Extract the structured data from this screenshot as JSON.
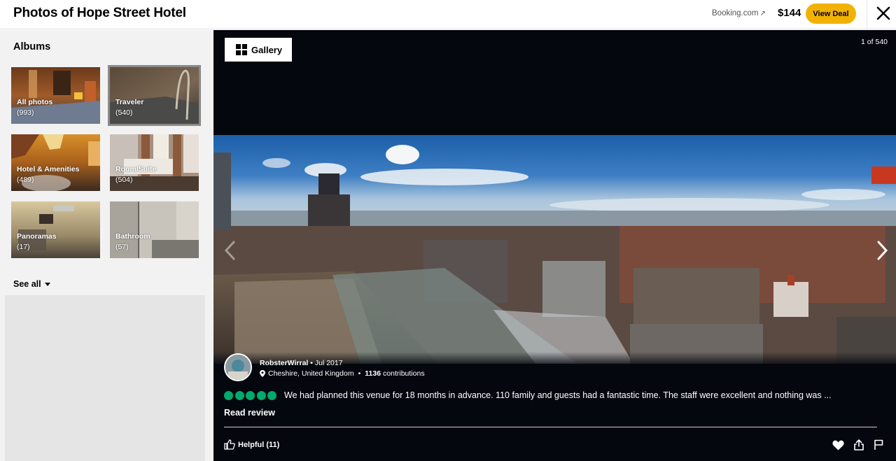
{
  "header": {
    "title": "Photos of Hope Street Hotel",
    "provider": "Booking.com",
    "provider_arrow": "↗",
    "price": "$144",
    "deal_label": "View Deal",
    "close_icon": "close-icon"
  },
  "sidebar": {
    "albums_title": "Albums",
    "albums": [
      {
        "label": "All photos",
        "count": "(993)",
        "selected": false
      },
      {
        "label": "Traveler",
        "count": "(540)",
        "selected": true
      },
      {
        "label": "Hotel & Amenities",
        "count": "(489)",
        "selected": false
      },
      {
        "label": "Room/Suite",
        "count": "(504)",
        "selected": false
      },
      {
        "label": "Panoramas",
        "count": "(17)",
        "selected": false
      },
      {
        "label": "Bathroom",
        "count": "(57)",
        "selected": false
      }
    ],
    "see_all_label": "See all"
  },
  "viewer": {
    "gallery_label": "Gallery",
    "counter": "1 of 540",
    "photo_description": "Panoramic rooftop view of Liverpool skyline",
    "review": {
      "username": "RobsterWirral",
      "date": "• Jul 2017",
      "location": "Cheshire, United Kingdom",
      "separator": "•",
      "contributions_count": "1136",
      "contributions_label": "contributions",
      "rating": 5,
      "rating_max": 5,
      "text": "We had planned this venue for 18 months in advance. 110 family and guests had a fantastic time. The staff were excellent and nothing was ...",
      "read_review_label": "Read review",
      "helpful_label": "Helpful (11)"
    }
  },
  "colors": {
    "accent": "#f2b203",
    "rating": "#00aa6c",
    "viewer_bg": "#04070e",
    "sidebar_bg": "#f2f2f2"
  }
}
